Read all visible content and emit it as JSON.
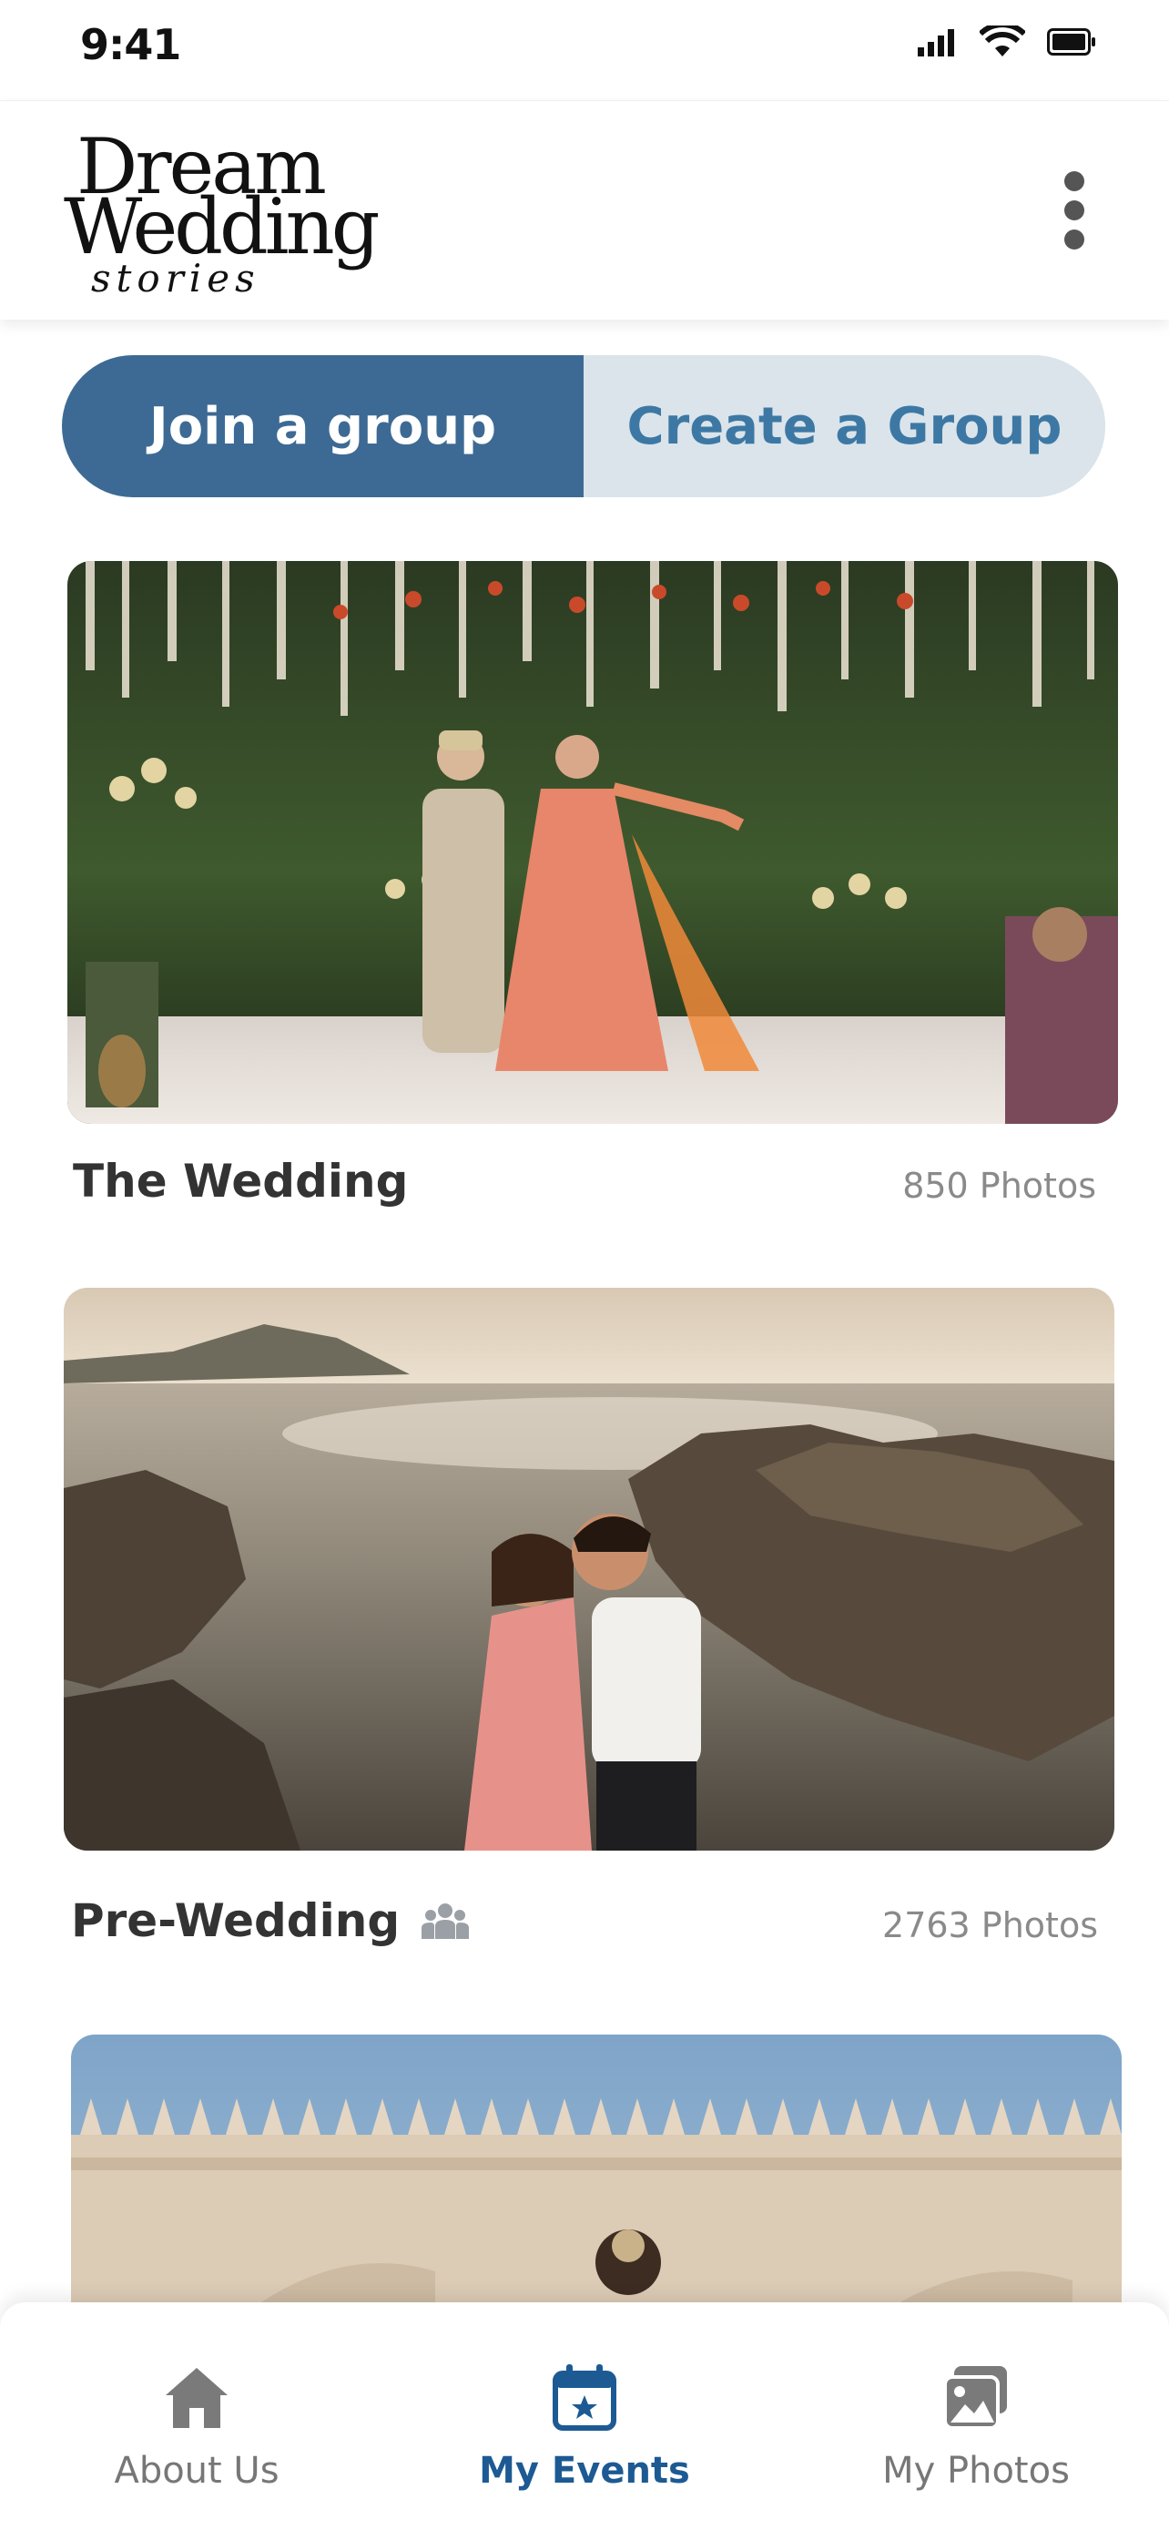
{
  "status": {
    "time": "9:41"
  },
  "brand": {
    "line1": "Dream",
    "line2": "Wedding",
    "line3": "stories"
  },
  "segmented": {
    "join_label": "Join a group",
    "create_label": "Create a Group"
  },
  "events": [
    {
      "title": "The Wedding",
      "count": "850 Photos",
      "group_icon": false
    },
    {
      "title": "Pre-Wedding",
      "count": "2763 Photos",
      "group_icon": true
    },
    {
      "title": "",
      "count": ""
    }
  ],
  "tabs": [
    {
      "label": "About Us",
      "icon": "home-icon",
      "active": false
    },
    {
      "label": "My Events",
      "icon": "calendar-star-icon",
      "active": true
    },
    {
      "label": "My Photos",
      "icon": "photos-icon",
      "active": false
    }
  ],
  "colors": {
    "primary": "#3d6a94",
    "segment_bg": "#dae4ea",
    "active_tab": "#1d5a94"
  }
}
